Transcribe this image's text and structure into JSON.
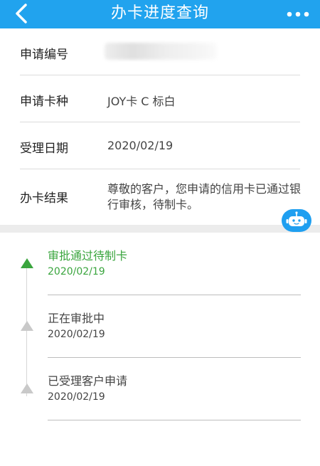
{
  "header": {
    "title": "办卡进度查询",
    "back_icon": "chevron-left-icon",
    "more_icon": "more-dots-icon",
    "color": "#21a3ee"
  },
  "info_rows": [
    {
      "label": "申请编号",
      "value": ""
    },
    {
      "label": "申请卡种",
      "value": "JOY卡 C 标白"
    },
    {
      "label": "受理日期",
      "value": "2020/02/19"
    },
    {
      "label": "办卡结果",
      "value": "尊敬的客户，您申请的信用卡已通过银行审核，待制卡。"
    }
  ],
  "assistant": {
    "icon": "robot-icon"
  },
  "timeline": [
    {
      "title": "审批通过待制卡",
      "date": "2020/02/19",
      "active": true
    },
    {
      "title": "正在审批中",
      "date": "2020/02/19",
      "active": false
    },
    {
      "title": "已受理客户申请",
      "date": "2020/02/19",
      "active": false
    }
  ],
  "colors": {
    "accent": "#21a3ee",
    "success": "#3aa53e",
    "inactive": "#c9c9c9"
  }
}
